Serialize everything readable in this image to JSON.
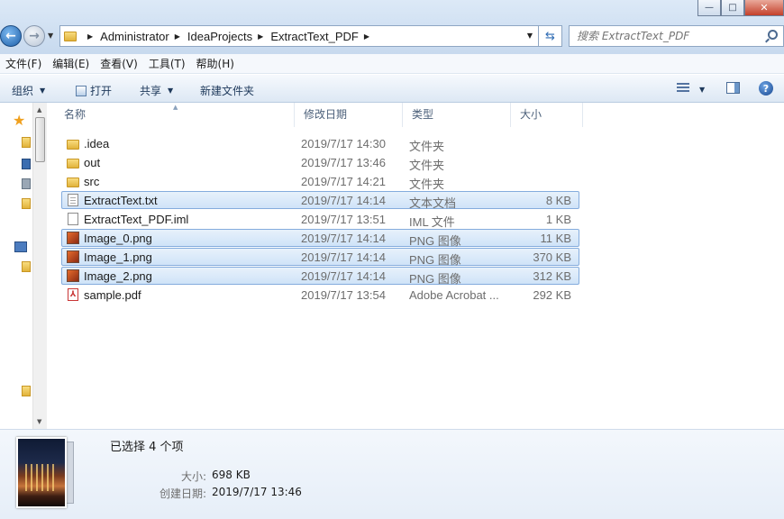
{
  "window": {
    "controls": {
      "minimize": "—",
      "maximize": "□",
      "close": "✕"
    }
  },
  "address": {
    "breadcrumbs": [
      "Administrator",
      "IdeaProjects",
      "ExtractText_PDF"
    ],
    "search_placeholder": "搜索 ExtractText_PDF"
  },
  "menu": [
    "文件(F)",
    "编辑(E)",
    "查看(V)",
    "工具(T)",
    "帮助(H)"
  ],
  "toolbar": {
    "organize": "组织",
    "open": "打开",
    "share": "共享",
    "new_folder": "新建文件夹",
    "help": "?"
  },
  "columns": {
    "name": "名称",
    "date": "修改日期",
    "type": "类型",
    "size": "大小"
  },
  "files": [
    {
      "name": ".idea",
      "date": "2019/7/17 14:30",
      "type": "文件夹",
      "size": "",
      "icon": "folder",
      "selected": false
    },
    {
      "name": "out",
      "date": "2019/7/17 13:46",
      "type": "文件夹",
      "size": "",
      "icon": "folder",
      "selected": false
    },
    {
      "name": "src",
      "date": "2019/7/17 14:21",
      "type": "文件夹",
      "size": "",
      "icon": "folder",
      "selected": false
    },
    {
      "name": "ExtractText.txt",
      "date": "2019/7/17 14:14",
      "type": "文本文档",
      "size": "8 KB",
      "icon": "txt",
      "selected": true
    },
    {
      "name": "ExtractText_PDF.iml",
      "date": "2019/7/17 13:51",
      "type": "IML 文件",
      "size": "1 KB",
      "icon": "iml",
      "selected": false
    },
    {
      "name": "Image_0.png",
      "date": "2019/7/17 14:14",
      "type": "PNG 图像",
      "size": "11 KB",
      "icon": "png",
      "selected": true
    },
    {
      "name": "Image_1.png",
      "date": "2019/7/17 14:14",
      "type": "PNG 图像",
      "size": "370 KB",
      "icon": "png",
      "selected": true
    },
    {
      "name": "Image_2.png",
      "date": "2019/7/17 14:14",
      "type": "PNG 图像",
      "size": "312 KB",
      "icon": "png",
      "selected": true
    },
    {
      "name": "sample.pdf",
      "date": "2019/7/17 13:54",
      "type": "Adobe Acrobat ...",
      "size": "292 KB",
      "icon": "pdf",
      "selected": false
    }
  ],
  "details": {
    "selection": "已选择 4 个项",
    "size_label": "大小:",
    "size_value": "698 KB",
    "created_label": "创建日期:",
    "created_value": "2019/7/17 13:46"
  }
}
